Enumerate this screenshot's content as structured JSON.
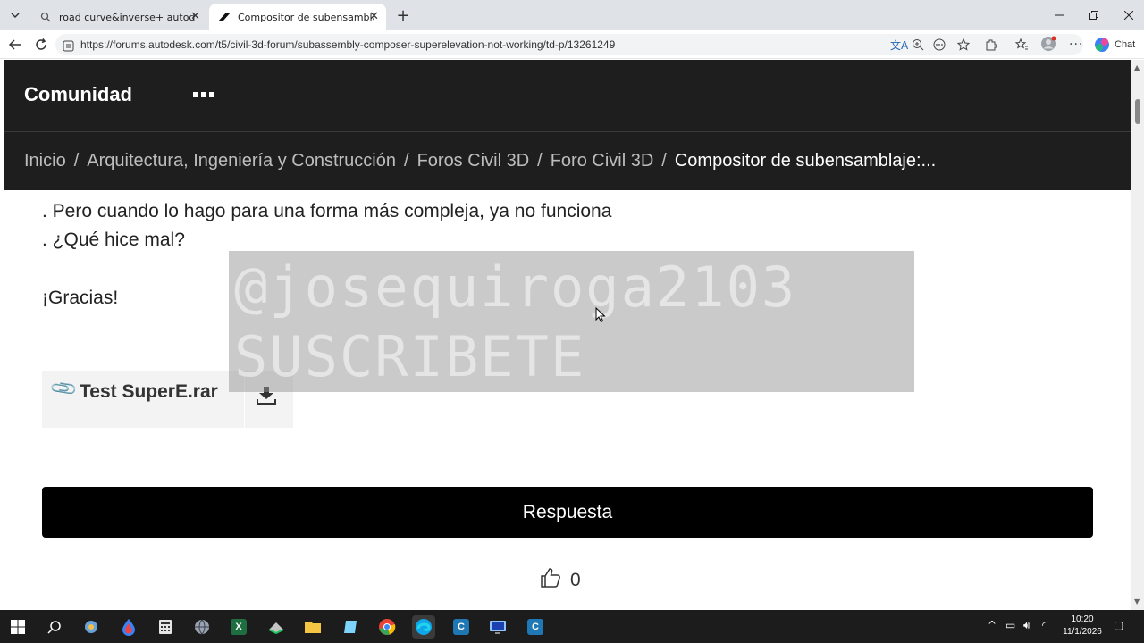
{
  "browser": {
    "tabs": [
      {
        "title": "road curve&inverse+ autodesk su",
        "icon": "search-icon",
        "active": false
      },
      {
        "title": "Compositor de subensamblaje: Su",
        "icon": "autodesk-logo-icon",
        "active": true
      }
    ],
    "url": "https://forums.autodesk.com/t5/civil-3d-forum/subassembly-composer-superelevation-not-working/td-p/13261249",
    "chat_label": "Chat"
  },
  "site": {
    "title": "Comunidad",
    "breadcrumb": [
      "Inicio",
      "Arquitectura, Ingeniería y Construcción",
      "Foros Civil 3D",
      "Foro Civil 3D",
      "Compositor de subensamblaje:..."
    ]
  },
  "post": {
    "line1": ". Pero cuando lo hago para una forma más compleja, ya no funciona",
    "line2": ". ¿Qué hice mal?",
    "thanks": "¡Gracias!",
    "attachment": "Test SuperE.rar"
  },
  "watermark": {
    "line1": "@josequiroga2103",
    "line2": "SUSCRIBETE"
  },
  "actions": {
    "reply_label": "Respuesta",
    "likes": "0"
  },
  "taskbar": {
    "time": "10:20",
    "date": "11/1/2026"
  },
  "colors": {
    "header_bg": "#1e1e1e",
    "reply_bg": "#000000",
    "tabstrip_bg": "#dfe3e8"
  }
}
